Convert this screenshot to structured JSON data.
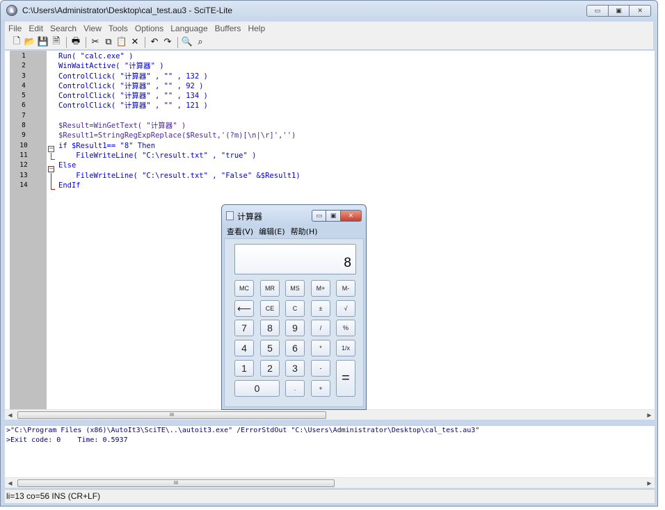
{
  "window": {
    "title": "C:\\Users\\Administrator\\Desktop\\cal_test.au3 - SciTE-Lite",
    "controls": {
      "minimize": "▭",
      "maximize": "▣",
      "close": "✕"
    }
  },
  "menubar": [
    "File",
    "Edit",
    "Search",
    "View",
    "Tools",
    "Options",
    "Language",
    "Buffers",
    "Help"
  ],
  "toolbar": {
    "icons": [
      "new-file-icon",
      "open-folder-icon",
      "save-icon",
      "close-file-icon",
      "print-icon",
      "cut-icon",
      "copy-icon",
      "paste-icon",
      "delete-icon",
      "undo-icon",
      "redo-icon",
      "find-icon",
      "replace-icon"
    ],
    "glyphs": [
      "🗋",
      "📂",
      "💾",
      "🗎",
      "🖶",
      "✂",
      "⧉",
      "📋",
      "✕",
      "↶",
      "↷",
      "🔍",
      "⌕"
    ]
  },
  "editor": {
    "lines": [
      {
        "num": "1",
        "text": "Run( \"calc.exe\" )"
      },
      {
        "num": "2",
        "text": "WinWaitActive( \"计算器\" )"
      },
      {
        "num": "3",
        "text": "ControlClick( \"计算器\" , \"\" , 132 )"
      },
      {
        "num": "4",
        "text": "ControlClick( \"计算器\" , \"\" , 92 )"
      },
      {
        "num": "5",
        "text": "ControlClick( \"计算器\" , \"\" , 134 )"
      },
      {
        "num": "6",
        "text": "ControlClick( \"计算器\" , \"\" , 121 )"
      },
      {
        "num": "7",
        "text": ""
      },
      {
        "num": "8",
        "text": "$Result=WinGetText( \"计算器\" )"
      },
      {
        "num": "9",
        "text": "$Result1=StringRegExpReplace($Result,'(?m)[\\n|\\r]','')"
      },
      {
        "num": "10",
        "text": "if $Result1== \"8\" Then"
      },
      {
        "num": "11",
        "text": "    FileWriteLine( \"C:\\result.txt\" , \"true\" )"
      },
      {
        "num": "12",
        "text": "Else"
      },
      {
        "num": "13",
        "text": "    FileWriteLine( \"C:\\result.txt\" , \"False\" &$Result1)"
      },
      {
        "num": "14",
        "text": "EndIf"
      }
    ]
  },
  "scroll": {
    "thumb_grip": "III"
  },
  "output": {
    "lines": [
      ">\"C:\\Program Files (x86)\\AutoIt3\\SciTE\\..\\autoit3.exe\" /ErrorStdOut \"C:\\Users\\Administrator\\Desktop\\cal_test.au3\"",
      ">Exit code: 0    Time: 0.5937"
    ]
  },
  "statusbar": {
    "text": "li=13 co=56 INS (CR+LF)"
  },
  "calculator": {
    "title": "计算器",
    "menu": [
      "查看(V)",
      "编辑(E)",
      "帮助(H)"
    ],
    "display": "8",
    "keys": {
      "mc": "MC",
      "mr": "MR",
      "ms": "MS",
      "mplus": "M+",
      "mminus": "M-",
      "back": "⟵",
      "ce": "CE",
      "c": "C",
      "plusminus": "±",
      "sqrt": "√",
      "k7": "7",
      "k8": "8",
      "k9": "9",
      "div": "/",
      "pct": "%",
      "k4": "4",
      "k5": "5",
      "k6": "6",
      "mul": "*",
      "recip": "1/x",
      "k1": "1",
      "k2": "2",
      "k3": "3",
      "sub": "-",
      "eq": "=",
      "k0": "0",
      "dot": ".",
      "add": "+"
    }
  }
}
